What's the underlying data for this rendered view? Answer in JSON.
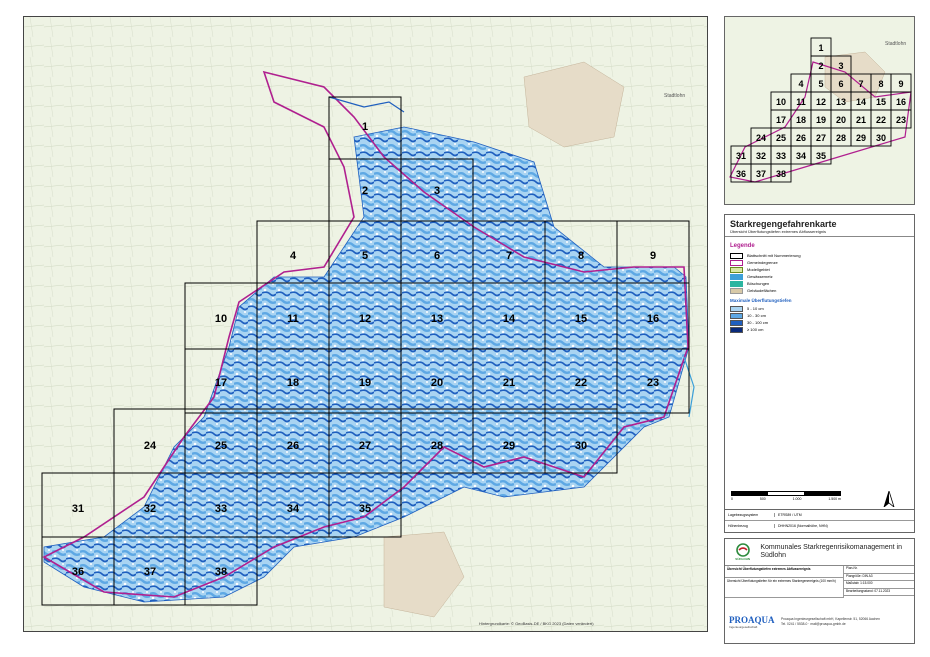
{
  "map": {
    "tile_labels": [
      "1",
      "2",
      "3",
      "4",
      "5",
      "6",
      "7",
      "8",
      "9",
      "10",
      "11",
      "12",
      "13",
      "14",
      "15",
      "16",
      "17",
      "18",
      "19",
      "20",
      "21",
      "22",
      "23",
      "24",
      "25",
      "26",
      "27",
      "28",
      "29",
      "30",
      "31",
      "32",
      "33",
      "34",
      "35",
      "36",
      "37",
      "38"
    ],
    "credits": "Hintergrundkarte: © GeoBasis-DE / BKG 2023 (Daten verändert)",
    "town_label": "Stadtlohn"
  },
  "inset": {
    "tiles": [
      "1",
      "2",
      "3",
      "4",
      "5",
      "6",
      "7",
      "8",
      "9",
      "10",
      "11",
      "12",
      "13",
      "14",
      "15",
      "16",
      "17",
      "18",
      "19",
      "20",
      "21",
      "22",
      "23",
      "24",
      "25",
      "26",
      "27",
      "28",
      "29",
      "30",
      "31",
      "32",
      "33",
      "34",
      "35",
      "36",
      "37",
      "38"
    ],
    "town_label": "Stadtlohn"
  },
  "panel": {
    "title": "Starkregengefahrenkarte",
    "subtitle": "Übersicht Überflutungstiefen extremes Abflussereignis",
    "legend_heading": "Legende",
    "legend_items": [
      {
        "label": "Blattschnitt mit Nummerierung",
        "color": "#ffffff",
        "border": "#000000"
      },
      {
        "label": "Gemeindegrenze",
        "color": "#ffffff",
        "border": "#b0208f"
      },
      {
        "label": "Modellgebiet",
        "color": "#d9e8a6",
        "border": "#6a8a20"
      },
      {
        "label": "Gewässernetz",
        "color": "#3da0d8",
        "border": "#3da0d8"
      },
      {
        "label": "Böschungen",
        "color": "#2cb5a0",
        "border": "#2cb5a0"
      },
      {
        "label": "Gebäudeflächen",
        "color": "#d7c9a8",
        "border": "#999999"
      }
    ],
    "depth_heading": "Maximale Überflutungstiefen",
    "depth_items": [
      {
        "label": "5 - 10 cm",
        "color": "#a9d4f2"
      },
      {
        "label": "10 - 30 cm",
        "color": "#5ea8e4"
      },
      {
        "label": "30 - 100 cm",
        "color": "#1f5fbf"
      },
      {
        "label": "≥ 100 cm",
        "color": "#0a2a7a"
      }
    ],
    "scale_ticks": [
      "0",
      "500",
      "1.000",
      "1.500 m"
    ],
    "meta_rows": [
      {
        "key": "Lagebezugssystem",
        "value": "ETRS89 / UTM"
      },
      {
        "key": "Höhenbezug",
        "value": "DHHN2016 (Normalhöhe, NHN)"
      }
    ],
    "project_title": "Kommunales Starkregenrisikomanagement in Südlohn",
    "project_logo_text": "SÜDLOHN",
    "rows_left": [
      "Übersicht Überflutungstiefen extremes Abflussereignis",
      "Übersicht Überflutungstiefen für ein extremes Starkregenereignis (100 mm/h)"
    ],
    "rows_right": [
      "Plan-Nr.",
      "Plangröße: DIN A3",
      "Maßstab: 1:15.000",
      "Bearbeitungsstand: 07.11.2023"
    ],
    "company_name": "PROAQUA",
    "company_sub": "Ingenieurgesellschaft",
    "company_address": "Proaqua Ingenieurgesellschaft mbH, Kapellenstr. 51, 52066 Aachen",
    "company_contact": "Tel. 0241 / 5538-0  ·  mail@proaqua-gmbh.de"
  },
  "colors": {
    "flood_light": "#a9d4f2",
    "flood_mid": "#5ea8e4",
    "flood_dark": "#1f5fbf",
    "flood_deep": "#0a2a7a",
    "boundary": "#b0208f",
    "background": "#eef3e4"
  }
}
